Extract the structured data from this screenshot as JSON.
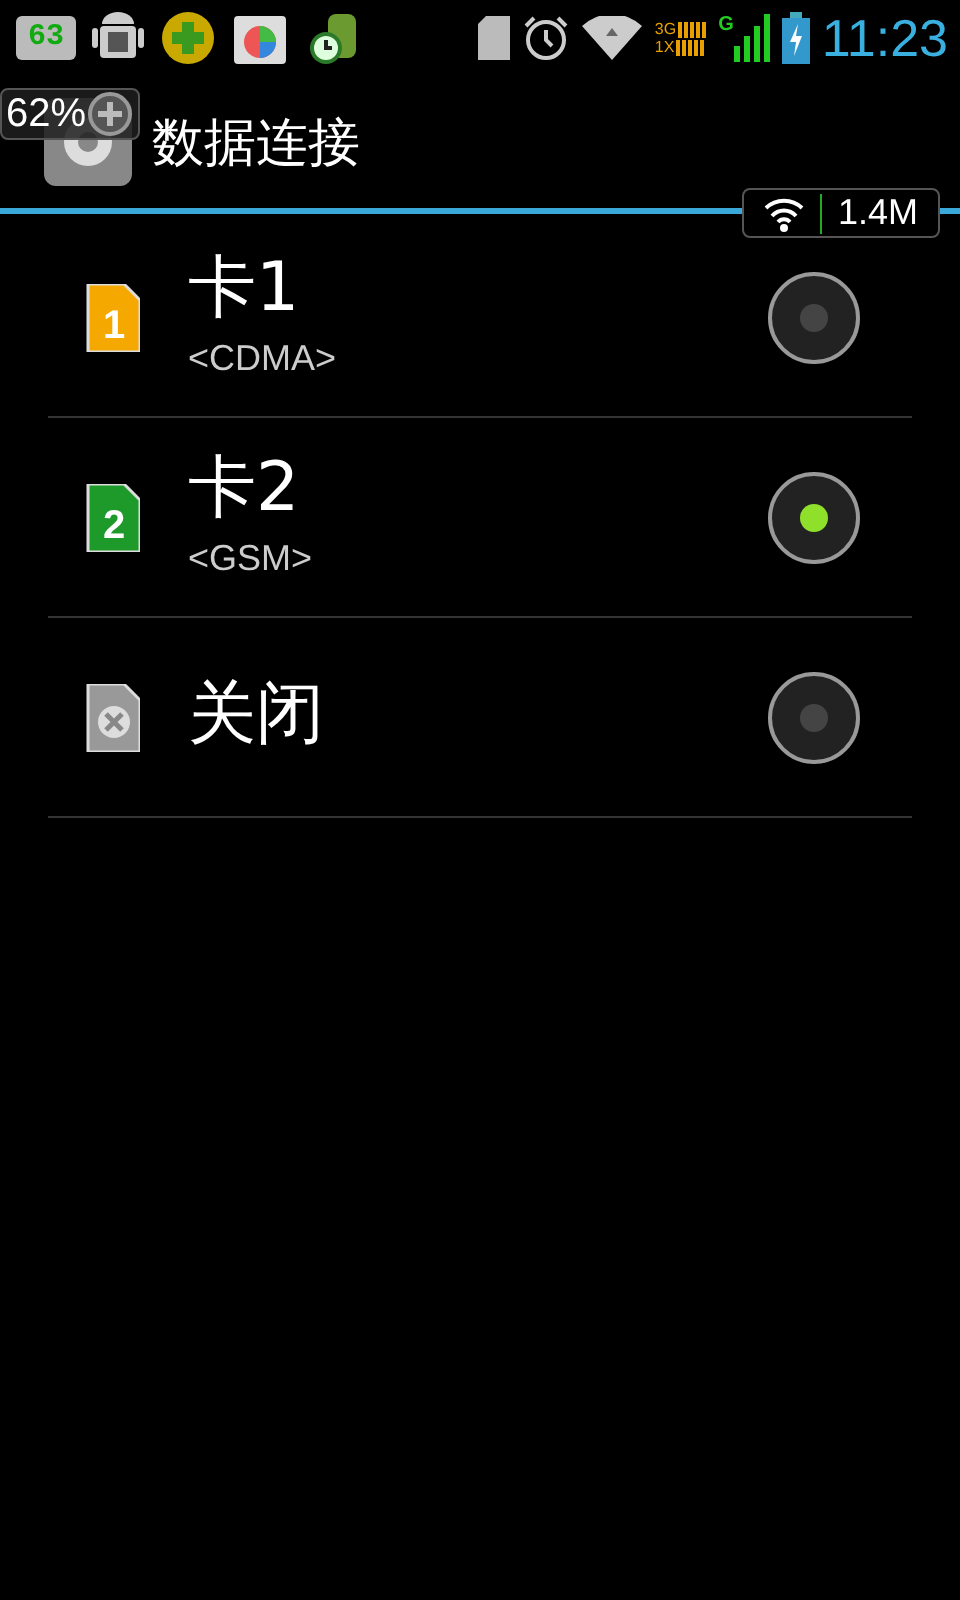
{
  "status_bar": {
    "battery_widget": "63",
    "network_labels": [
      "3G",
      "1X"
    ],
    "signal_label": "G",
    "time": "11:23"
  },
  "header": {
    "title": "数据连接"
  },
  "overlays": {
    "memory_widget": "62%",
    "net_speed": "1.4M"
  },
  "options": [
    {
      "kind": "sim",
      "sim_label": "1",
      "color": "#f5a800",
      "title": "卡1",
      "subtitle": "<CDMA>",
      "selected": false
    },
    {
      "kind": "sim",
      "sim_label": "2",
      "color": "#1e9a2a",
      "title": "卡2",
      "subtitle": "<GSM>",
      "selected": true
    },
    {
      "kind": "off",
      "title": "关闭",
      "selected": false
    }
  ]
}
